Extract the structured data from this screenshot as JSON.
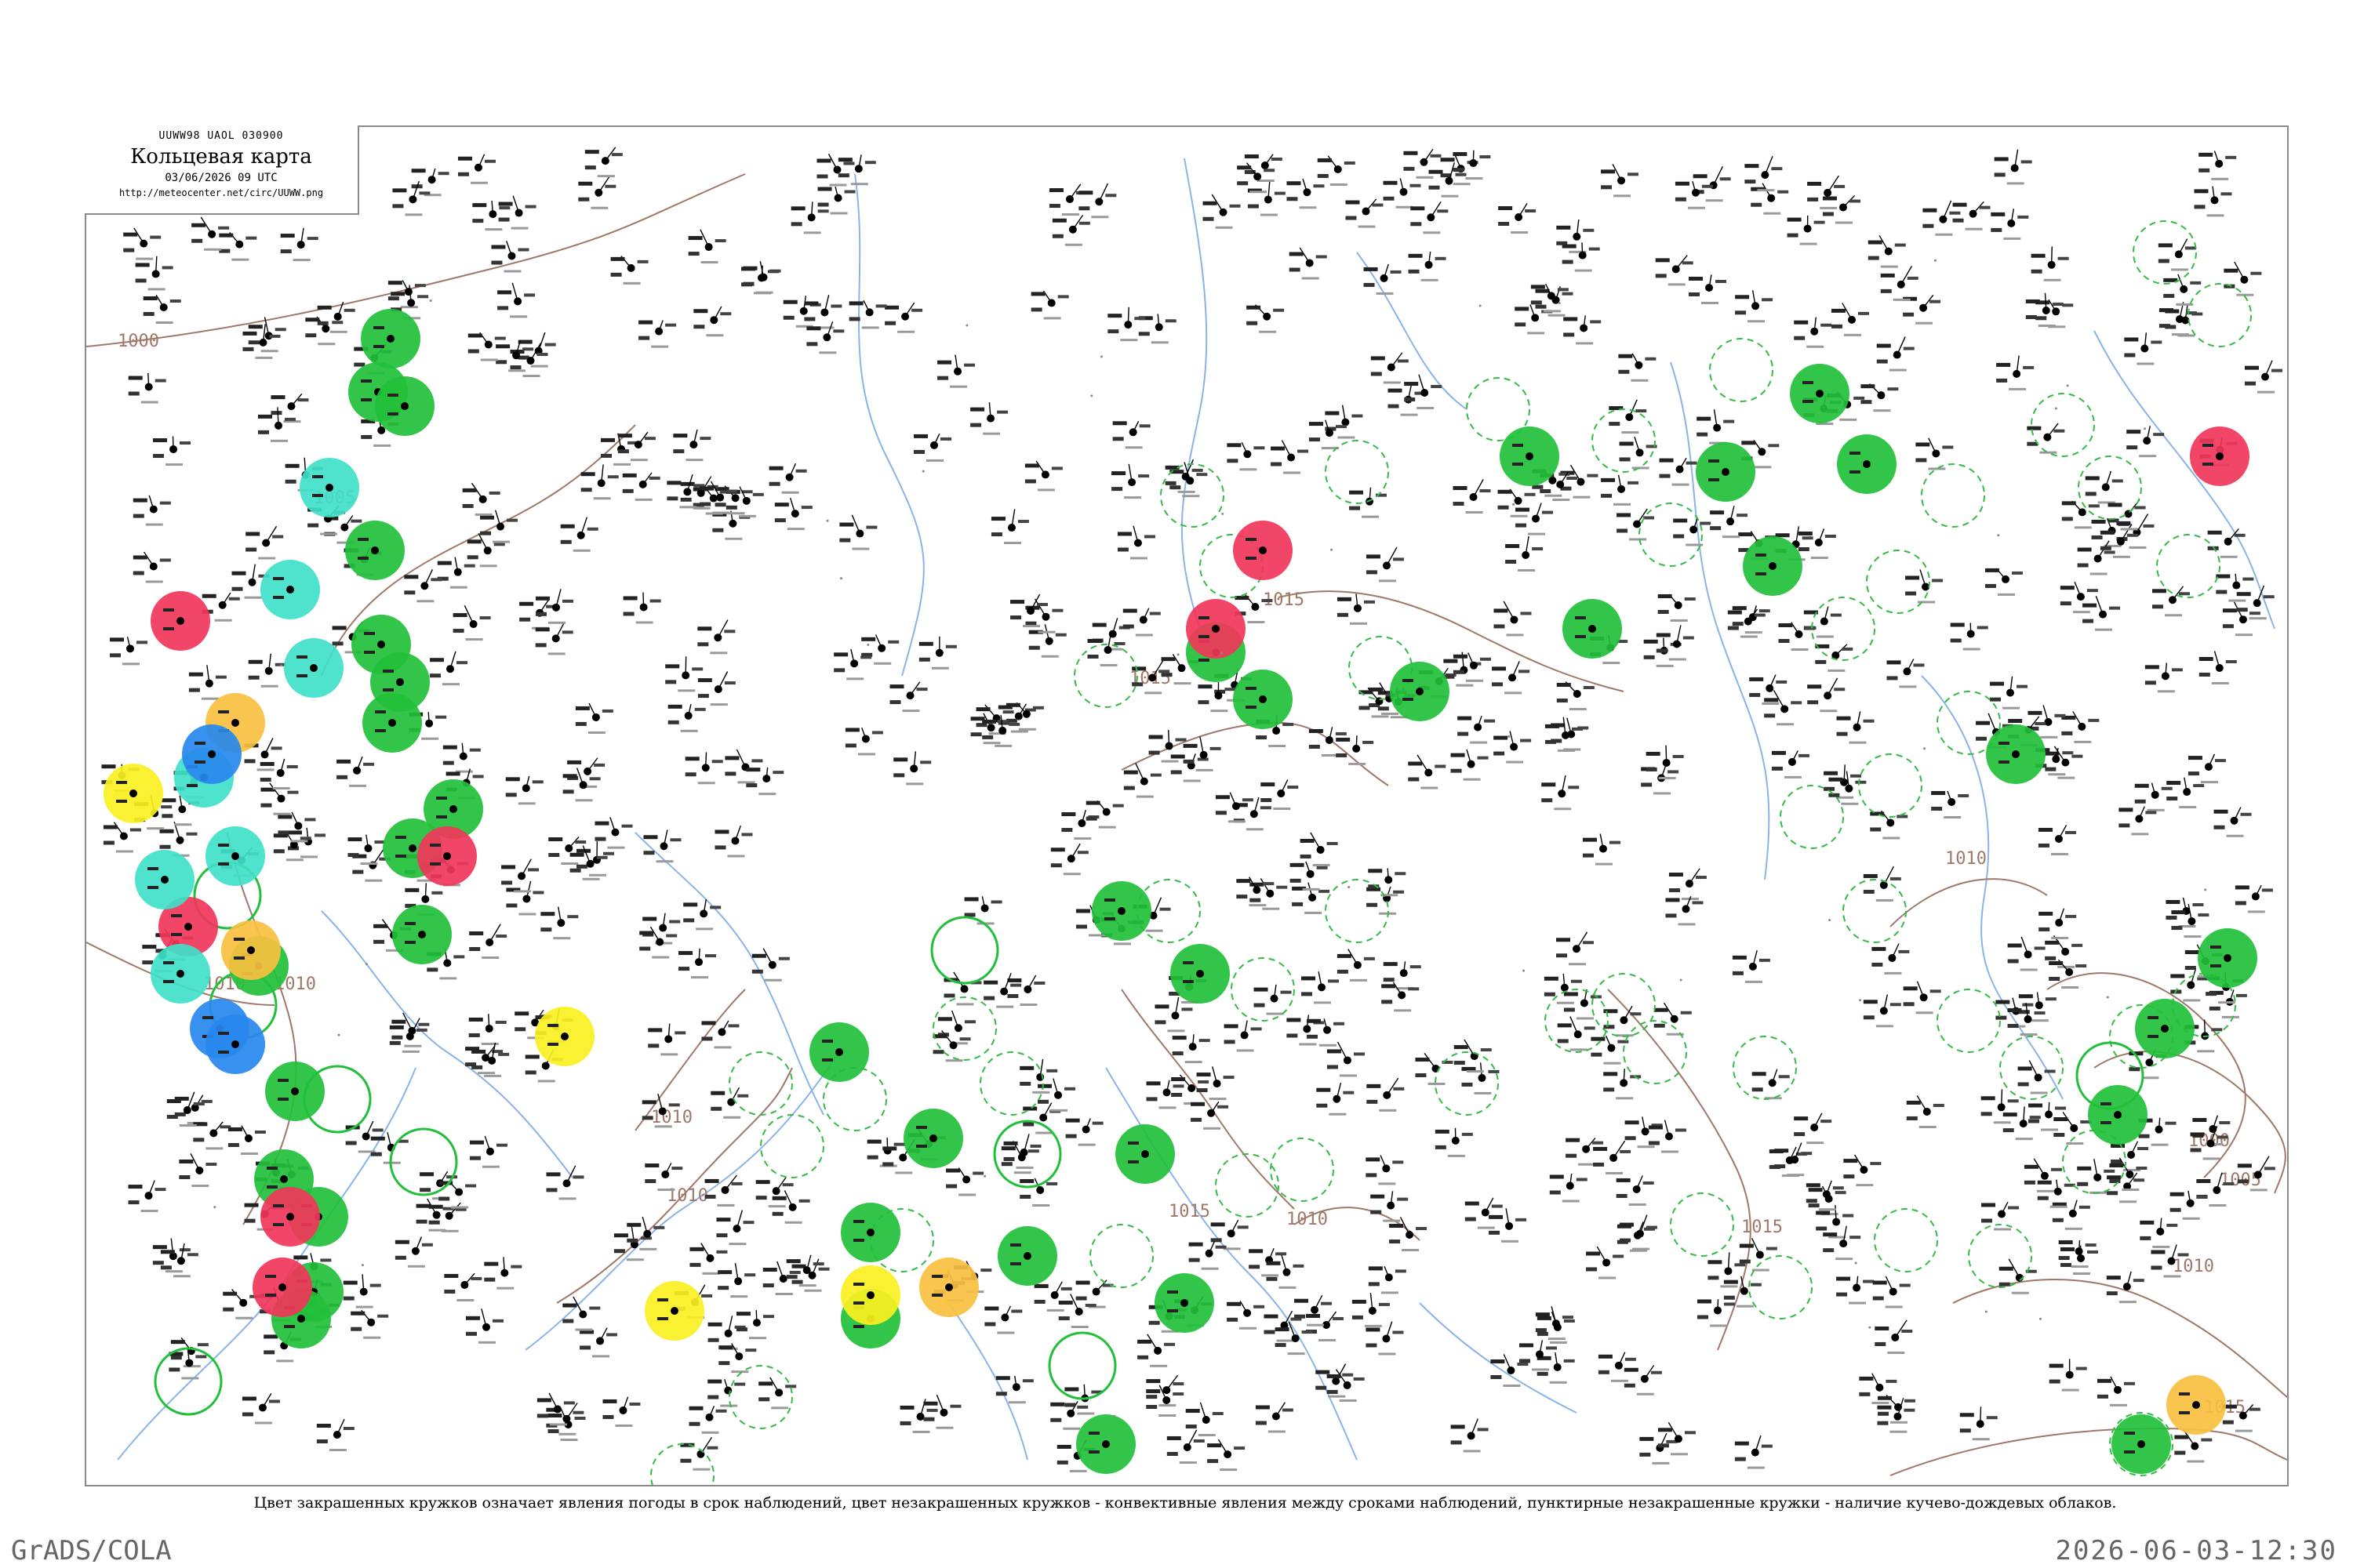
{
  "header": {
    "code_line": "UUWW98 UAOL 030900",
    "title": "Кольцевая карта",
    "date_line": "03/06/2026 09 UTC",
    "url": "http://meteocenter.net/circ/UUWW.png"
  },
  "isobar_labels": [
    "1000",
    "1005",
    "1010",
    "1015"
  ],
  "caption": "Цвет закрашенных кружков означает явления погоды в срок наблюдений, цвет незакрашенных кружков - конвективные явления между сроками наблюдений, пунктирные незакрашенные кружки - наличие кучево-дождевых облаков.",
  "footer": {
    "left": "GrADS/COLA",
    "right": "2026-06-03-12:30"
  },
  "colors": {
    "rain_green": "#22c03a",
    "thunder_red": "#f0365a",
    "shower_cyan": "#40e0c8",
    "fog_yellow": "#f8f020",
    "haze_orange": "#f8c040",
    "snow_blue": "#2888ee",
    "isobar": "#a0786a",
    "river": "#8ab4e8",
    "cb_dashed": "#33bb44"
  }
}
